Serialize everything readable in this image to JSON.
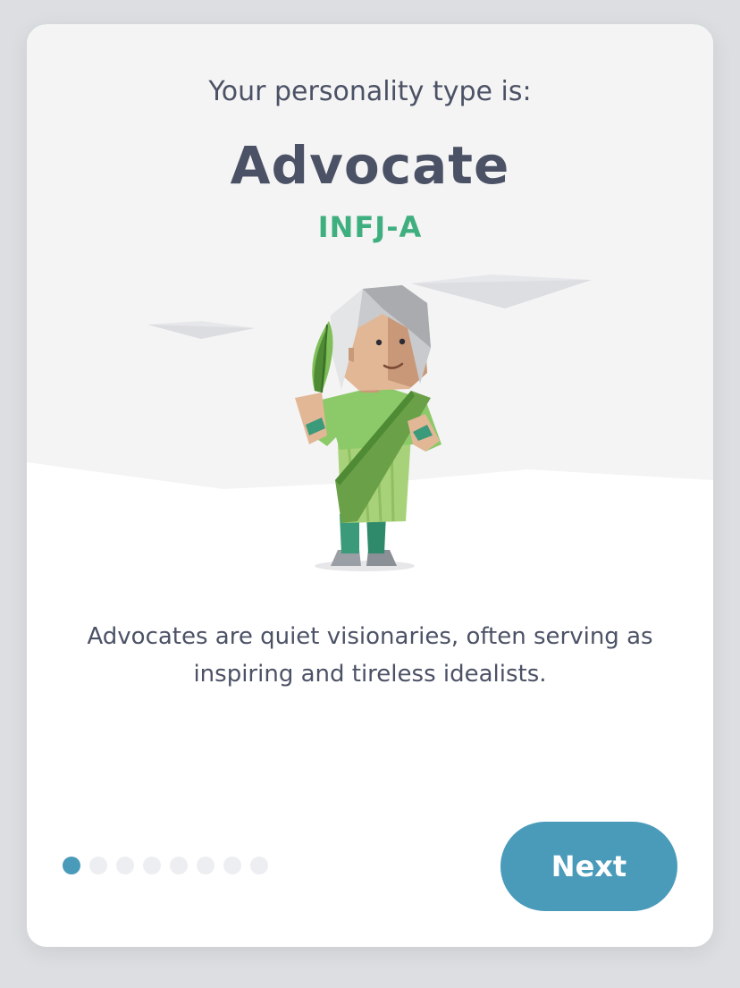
{
  "header": {
    "subtitle": "Your personality type is:",
    "type_name": "Advocate",
    "type_code": "INFJ-A"
  },
  "description": "Advocates are quiet visionaries, often serving as inspiring and tireless idealists.",
  "pagination": {
    "total_steps": 8,
    "current_step": 1
  },
  "actions": {
    "next_label": "Next"
  },
  "colors": {
    "accent_green": "#3faf7f",
    "primary_blue": "#4a9bba",
    "text_dark": "#4c5266"
  },
  "illustration": {
    "icon": "advocate-character-illustration"
  }
}
